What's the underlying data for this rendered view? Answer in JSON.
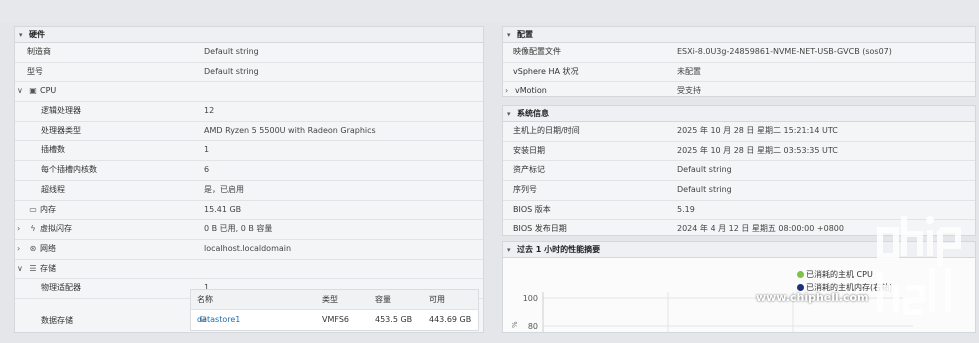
{
  "hardware": {
    "title": "硬件",
    "rows": [
      {
        "label": "制造商",
        "value": "Default string"
      },
      {
        "label": "型号",
        "value": "Default string"
      },
      {
        "label": "CPU",
        "value": ""
      },
      {
        "label": "逻辑处理器",
        "value": "12"
      },
      {
        "label": "处理器类型",
        "value": "AMD Ryzen 5 5500U with Radeon Graphics"
      },
      {
        "label": "插槽数",
        "value": "1"
      },
      {
        "label": "每个插槽内核数",
        "value": "6"
      },
      {
        "label": "超线程",
        "value": "是，已启用"
      },
      {
        "label": "内存",
        "value": "15.41 GB"
      },
      {
        "label": "虚拟闪存",
        "value": "0 B 已用, 0 B 容量"
      },
      {
        "label": "网络",
        "value": "localhost.localdomain"
      },
      {
        "label": "存储",
        "value": ""
      },
      {
        "label": "物理适配器",
        "value": "1"
      },
      {
        "label": "数据存储",
        "value": ""
      }
    ],
    "datastore_table": {
      "headers": [
        "名称",
        "类型",
        "容量",
        "可用"
      ],
      "row": {
        "name": "datastore1",
        "type": "VMFS6",
        "capacity": "453.5 GB",
        "free": "443.69 GB"
      }
    }
  },
  "config": {
    "title": "配置",
    "rows": [
      {
        "label": "映像配置文件",
        "value": "ESXi-8.0U3g-24859861-NVME-NET-USB-GVCB (sos07)"
      },
      {
        "label": "vSphere HA 状况",
        "value": "未配置"
      },
      {
        "label": "vMotion",
        "value": "受支持"
      }
    ]
  },
  "sysinfo": {
    "title": "系统信息",
    "rows": [
      {
        "label": "主机上的日期/时间",
        "value": "2025 年 10 月 28 日 星期二 15:21:14 UTC"
      },
      {
        "label": "安装日期",
        "value": "2025 年 10 月 28 日 星期二 03:53:35 UTC"
      },
      {
        "label": "资产标记",
        "value": "Default string"
      },
      {
        "label": "序列号",
        "value": "Default string"
      },
      {
        "label": "BIOS 版本",
        "value": "5.19"
      },
      {
        "label": "BIOS 发布日期",
        "value": "2024 年 4 月 12 日 星期五 08:00:00 +0800"
      }
    ]
  },
  "perf": {
    "title": "过去 1 小时的性能摘要",
    "legend": [
      {
        "label": "已消耗的主机 CPU",
        "color": "#7cc24a"
      },
      {
        "label": "已消耗的主机内存(右轴)",
        "color": "#1f2f7a"
      }
    ],
    "y_ticks": [
      "100",
      "80"
    ]
  },
  "watermark": {
    "logo_text": "chip hell",
    "url": "www.chiphell.com"
  },
  "chart_data": {
    "type": "line",
    "title": "过去 1 小时的性能摘要",
    "series": [
      {
        "name": "已消耗的主机 CPU",
        "values": []
      },
      {
        "name": "已消耗的主机内存(右轴)",
        "values": []
      }
    ],
    "y_ticks": [
      100,
      80
    ],
    "legend_position": "top-right",
    "grid": true
  }
}
